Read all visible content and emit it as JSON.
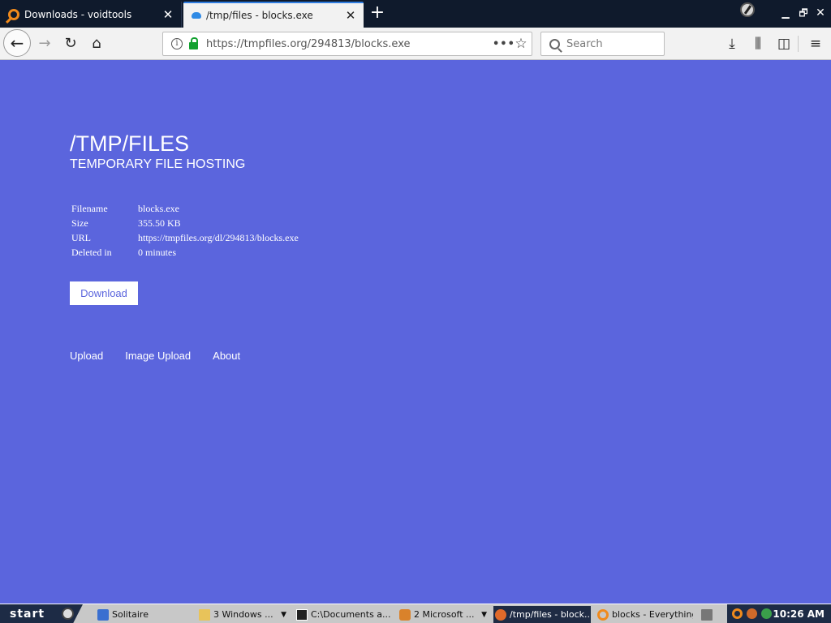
{
  "browser": {
    "tabs": [
      {
        "title": "Downloads - voidtools",
        "icon": "search-icon",
        "active": false
      },
      {
        "title": "/tmp/files - blocks.exe",
        "icon": "cloud-upload-icon",
        "active": true
      }
    ],
    "tab_close_glyph": "✕",
    "new_tab_glyph": "+",
    "window_controls": {
      "minimize": "▁",
      "maximize": "🗗",
      "close": "✕"
    },
    "url": "https://tmpfiles.org/294813/blocks.exe",
    "search_placeholder": "Search",
    "nav_glyphs": {
      "back": "←",
      "forward": "→",
      "reload": "↻",
      "home": "⌂",
      "info": "i",
      "more": "•••",
      "star": "☆",
      "download": "⤓",
      "library": "⫼",
      "sidebar": "◫",
      "menu": "≡"
    }
  },
  "page": {
    "title": "/TMP/FILES",
    "subtitle": "TEMPORARY FILE HOSTING",
    "info_rows": [
      {
        "label": "Filename",
        "value": "blocks.exe"
      },
      {
        "label": "Size",
        "value": "355.50 KB"
      },
      {
        "label": "URL",
        "value": "https://tmpfiles.org/dl/294813/blocks.exe"
      },
      {
        "label": "Deleted in",
        "value": "0 minutes"
      }
    ],
    "download_button": "Download",
    "footer_links": [
      "Upload",
      "Image Upload",
      "About"
    ]
  },
  "taskbar": {
    "start_label": "start",
    "tasks": [
      {
        "label": "Solitaire",
        "icon": "solitaire-icon",
        "has_arrow": false,
        "active": false
      },
      {
        "label": "3 Windows ...",
        "icon": "folder-icon",
        "has_arrow": true,
        "active": false
      },
      {
        "label": "C:\\Documents a...",
        "icon": "7zip-icon",
        "has_arrow": false,
        "active": false
      },
      {
        "label": "2 Microsoft ...",
        "icon": "office-icon",
        "has_arrow": true,
        "active": false
      },
      {
        "label": "/tmp/files - block...",
        "icon": "firefox-icon",
        "has_arrow": false,
        "active": true
      },
      {
        "label": "blocks - Everything",
        "icon": "search-icon",
        "has_arrow": false,
        "active": false
      }
    ],
    "clock": "10:26 AM"
  },
  "colors": {
    "page_background": "#5b65dd",
    "accent_blue": "#2f7de1",
    "lock_green": "#12a12f",
    "everything_orange": "#f08a1c",
    "taskbar_dark": "#1d2b45"
  }
}
